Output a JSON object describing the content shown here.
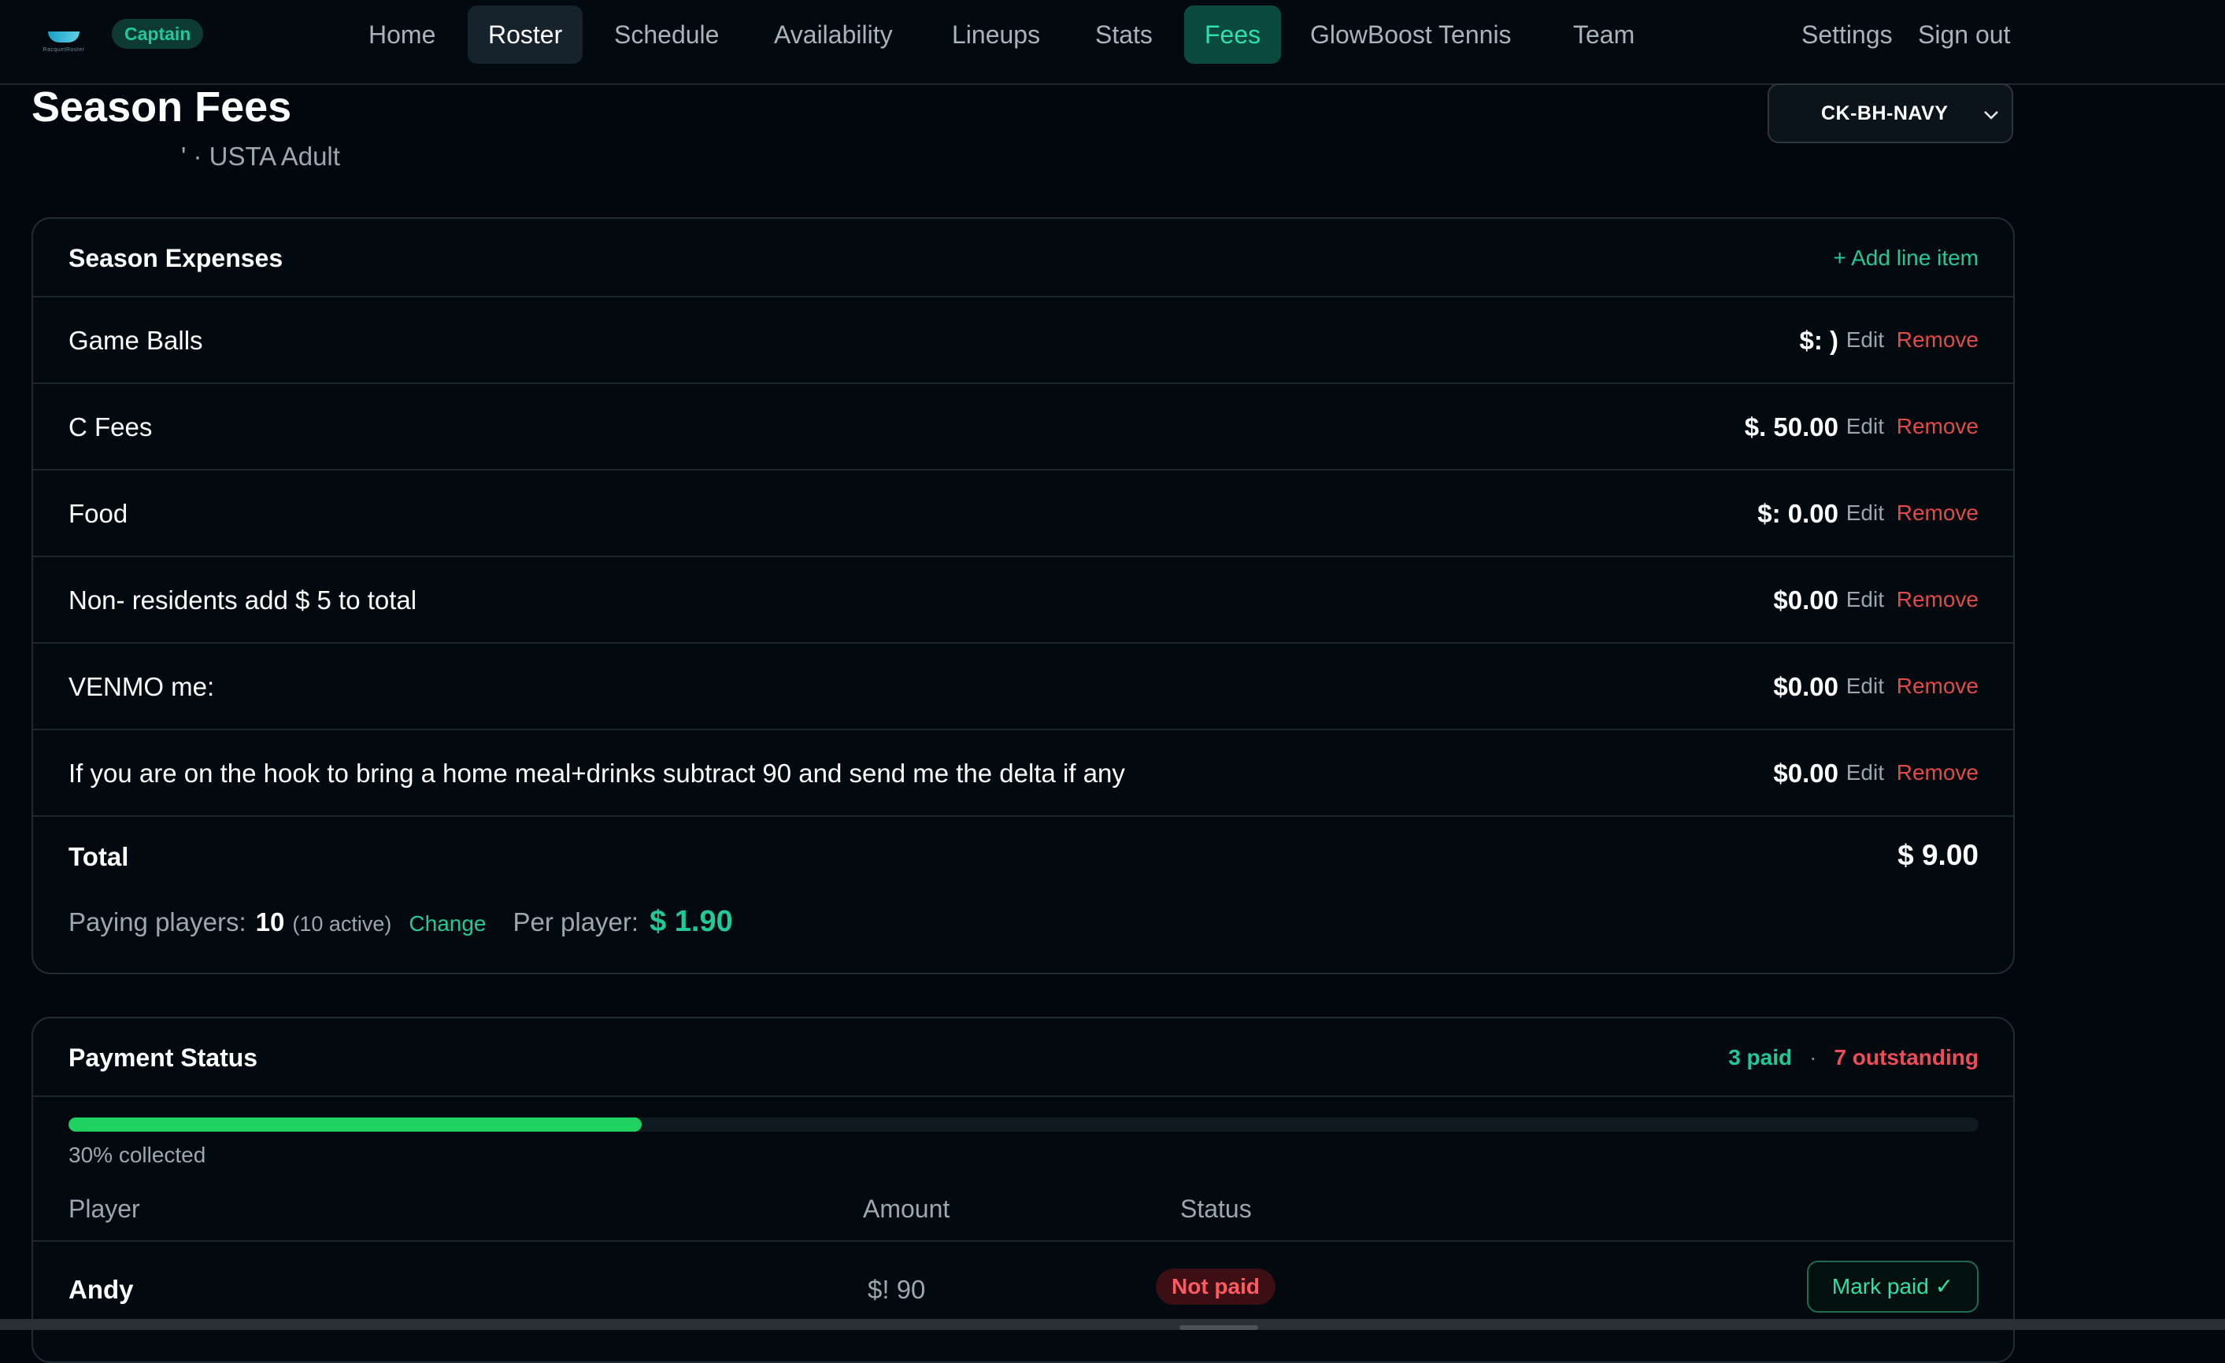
{
  "brand": {
    "logo_text": "RacquetRoster",
    "role_badge": "Captain"
  },
  "nav": {
    "items": [
      {
        "label": "Home"
      },
      {
        "label": "Roster"
      },
      {
        "label": "Schedule"
      },
      {
        "label": "Availability"
      },
      {
        "label": "Lineups"
      },
      {
        "label": "Stats"
      },
      {
        "label": "Fees"
      },
      {
        "label": "GlowBoost Tennis"
      },
      {
        "label": "Team"
      }
    ],
    "settings": "Settings",
    "signout": "Sign out"
  },
  "header": {
    "title": "Season Fees",
    "subtitle": "' · USTA Adult",
    "team_select": "CK-BH-NAVY"
  },
  "expenses": {
    "title": "Season Expenses",
    "add_label": "+ Add line item",
    "edit_label": "Edit",
    "remove_label": "Remove",
    "items": [
      {
        "label": "Game Balls",
        "amount": "$:        )"
      },
      {
        "label": " C Fees",
        "amount": "$.  50.00"
      },
      {
        "label": "Food",
        "amount": "$:  0.00"
      },
      {
        "label": "Non-     residents add $  5 to total",
        "amount": "$0.00"
      },
      {
        "label": "VENMO me: ",
        "amount": "$0.00"
      },
      {
        "label": "If you are on the hook to bring a home meal+drinks subtract      90 and send me the delta if any",
        "amount": "$0.00"
      }
    ],
    "total_label": "Total",
    "total_amount": "$    9.00",
    "paying_label": "Paying players:",
    "paying_count": "10",
    "paying_active": "(10 active)",
    "change_label": "Change",
    "per_player_label": "Per player:",
    "per_player_amount": "$   1.90"
  },
  "payments": {
    "title": "Payment Status",
    "paid_text": "3 paid",
    "separator": "·",
    "outstanding_text": "7 outstanding",
    "progress_fraction": 0.3,
    "progress_text": "30% collected",
    "columns": {
      "player": "Player",
      "amount": "Amount",
      "status": "Status"
    },
    "rows": [
      {
        "player": "Andy",
        "amount": "$!   90",
        "status": "Not paid",
        "action": "Mark paid ✓"
      }
    ]
  },
  "colors": {
    "accent": "#21c997",
    "danger": "#e24a4a",
    "progress": "#1fd15f",
    "background": "#01070d"
  }
}
